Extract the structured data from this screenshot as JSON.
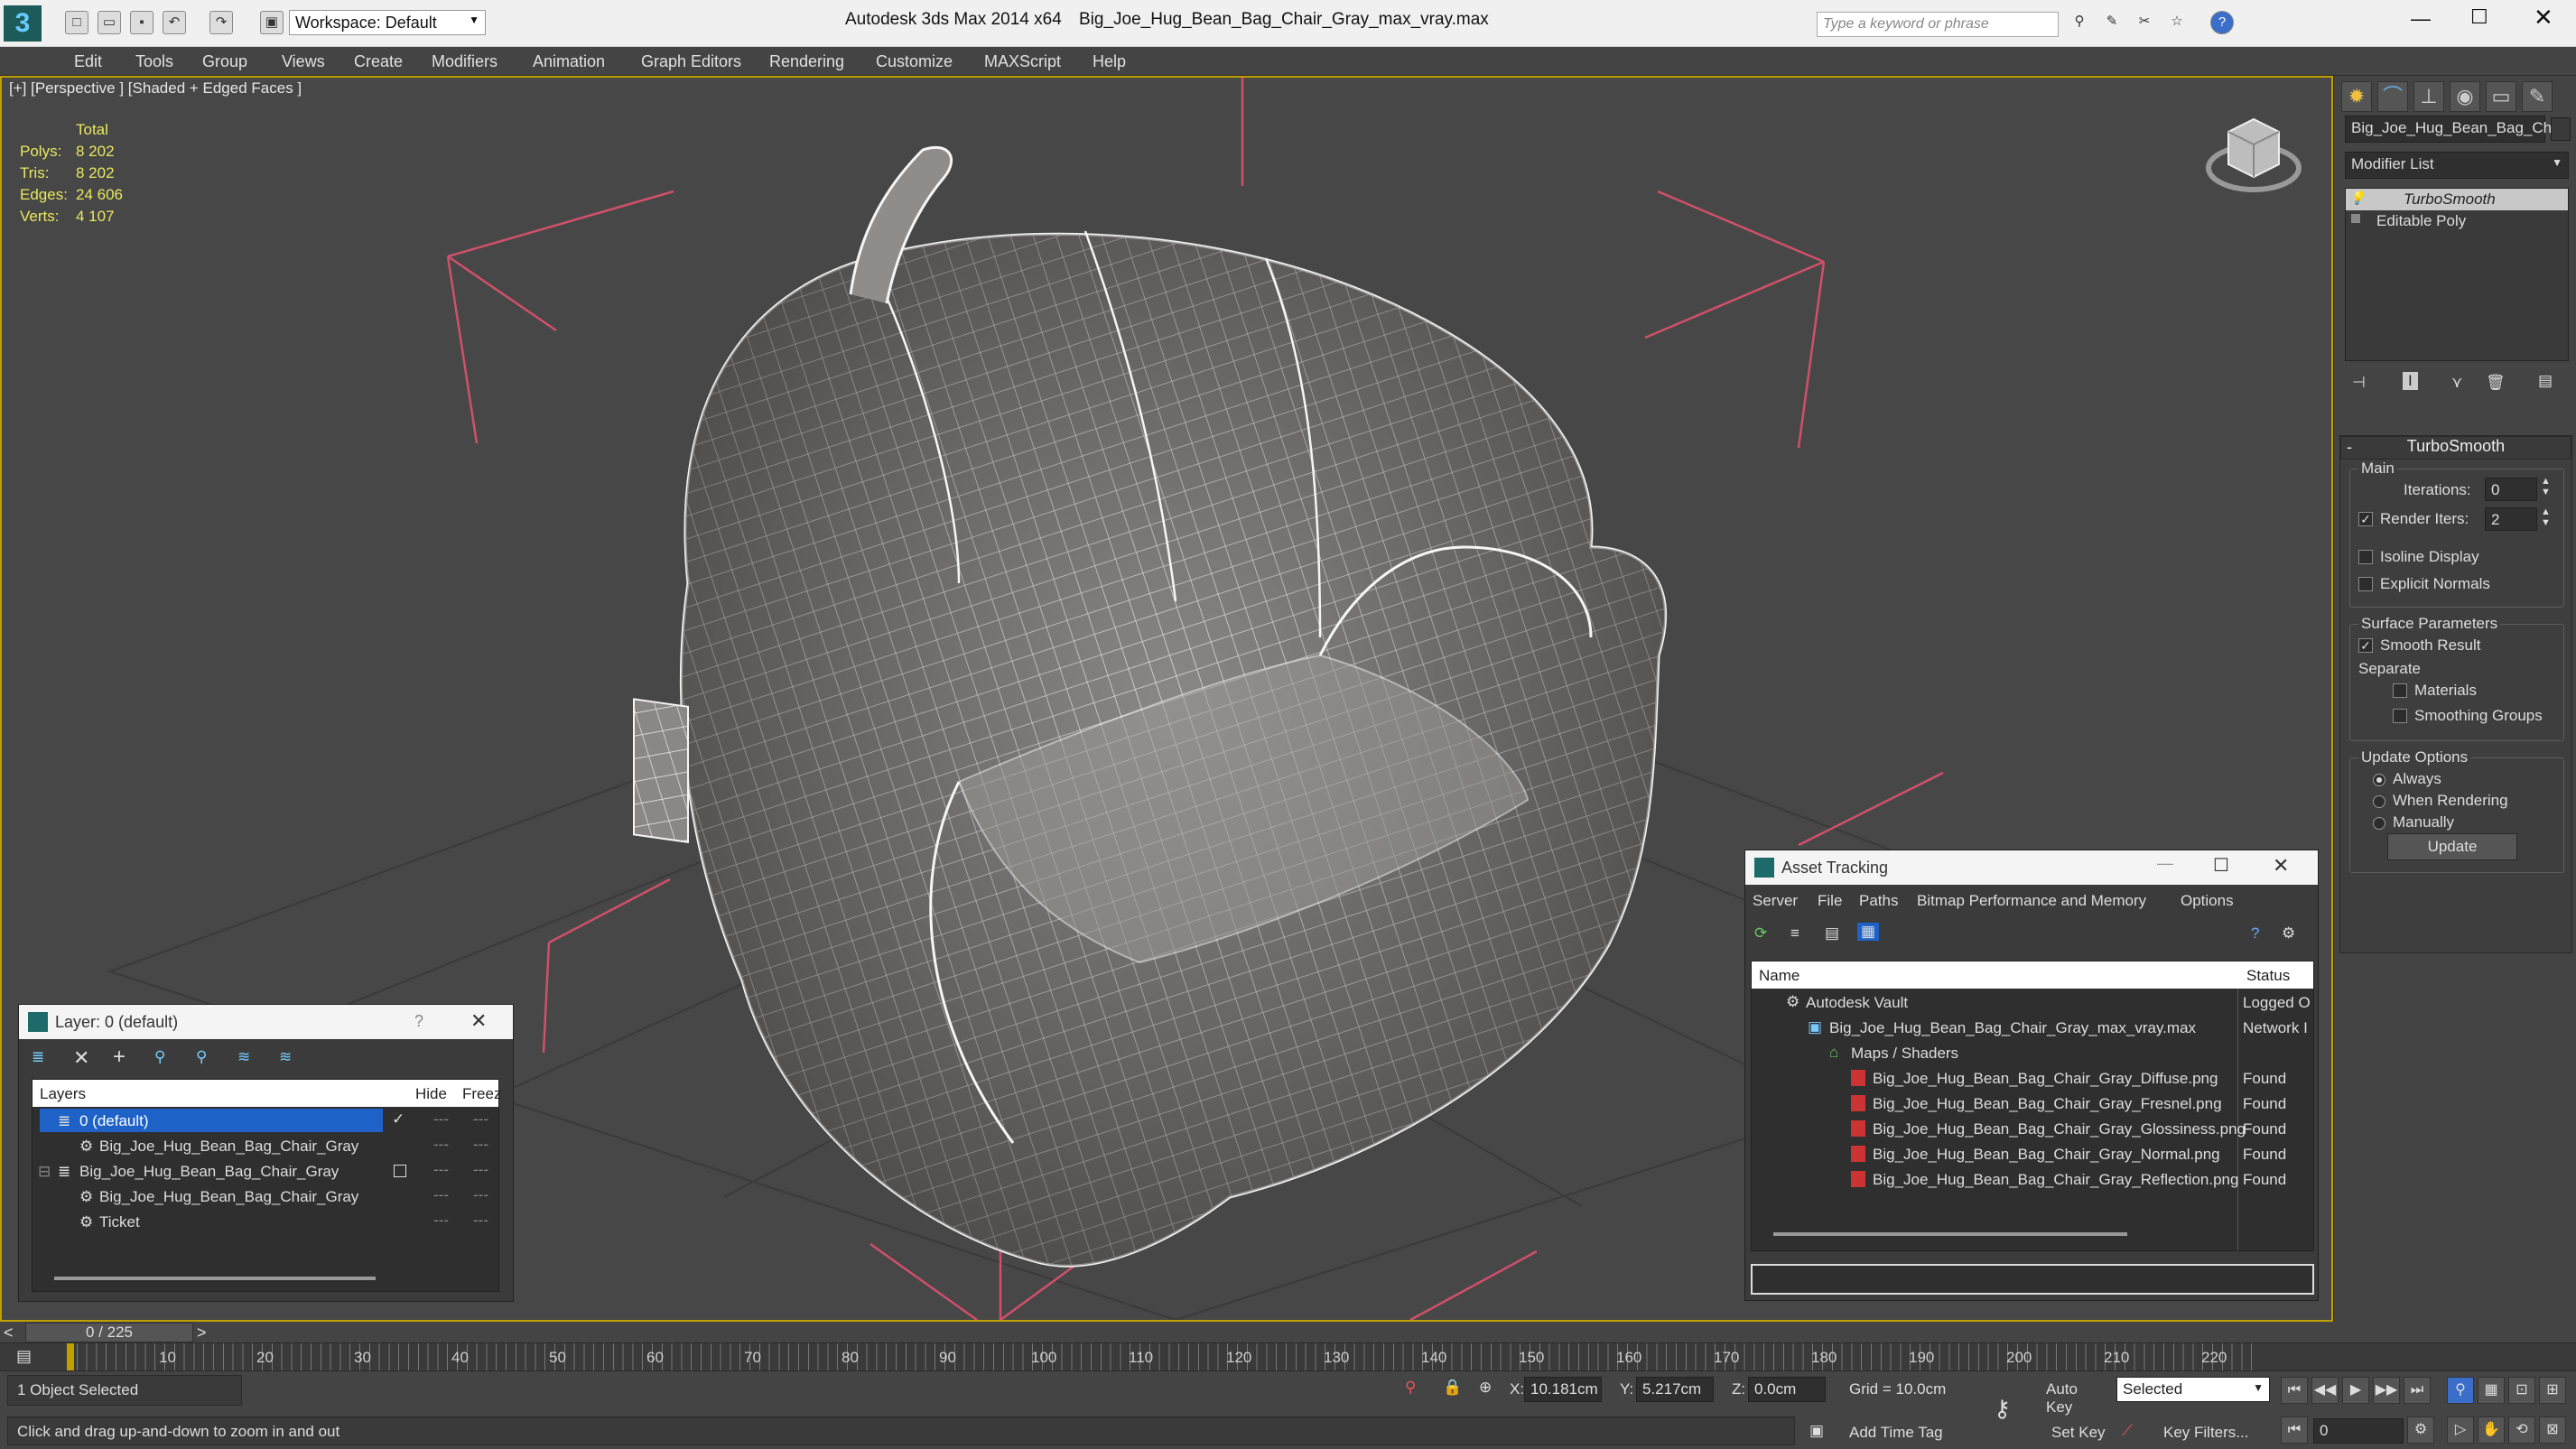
{
  "window": {
    "app_title": "Autodesk 3ds Max  2014 x64",
    "file_title": "Big_Joe_Hug_Bean_Bag_Chair_Gray_max_vray.max",
    "workspace": "Workspace: Default",
    "search_placeholder": "Type a keyword or phrase"
  },
  "menu": [
    "Edit",
    "Tools",
    "Group",
    "Views",
    "Create",
    "Modifiers",
    "Animation",
    "Graph Editors",
    "Rendering",
    "Customize",
    "MAXScript",
    "Help"
  ],
  "viewport": {
    "label": "[+] [Perspective ] [Shaded + Edged Faces ]",
    "stats": {
      "header": "Total",
      "rows": [
        {
          "k": "Polys:",
          "v": "8 202"
        },
        {
          "k": "Tris:",
          "v": "8 202"
        },
        {
          "k": "Edges:",
          "v": "24 606"
        },
        {
          "k": "Verts:",
          "v": "4 107"
        }
      ]
    }
  },
  "command_panel": {
    "object_name": "Big_Joe_Hug_Bean_Bag_Cha",
    "modifier_list": "Modifier List",
    "stack": [
      "TurboSmooth",
      "Editable Poly"
    ],
    "turbosmooth": {
      "title": "TurboSmooth",
      "main": "Main",
      "iterations_label": "Iterations:",
      "iterations": "0",
      "render_iters_label": "Render Iters:",
      "render_iters": "2",
      "isoline": "Isoline Display",
      "explicit_normals": "Explicit Normals",
      "surface_params": "Surface Parameters",
      "smooth_result": "Smooth Result",
      "separate": "Separate",
      "materials": "Materials",
      "smoothing_groups": "Smoothing Groups",
      "update_options": "Update Options",
      "always": "Always",
      "when_rendering": "When Rendering",
      "manually": "Manually",
      "update_button": "Update"
    }
  },
  "layer_dialog": {
    "title": "Layer: 0 (default)",
    "help": "?",
    "col_layers": "Layers",
    "col_hide": "Hide",
    "col_freeze": "Freez",
    "rows": [
      {
        "name": "0 (default)",
        "selected": true
      },
      {
        "name": "Big_Joe_Hug_Bean_Bag_Chair_Gray",
        "selected": false
      },
      {
        "name": "Big_Joe_Hug_Bean_Bag_Chair_Gray",
        "selected": false
      },
      {
        "name": "Big_Joe_Hug_Bean_Bag_Chair_Gray",
        "selected": false
      },
      {
        "name": "Ticket",
        "selected": false
      }
    ]
  },
  "asset_tracking": {
    "title": "Asset Tracking",
    "menu": [
      "Server",
      "File",
      "Paths",
      "Bitmap Performance and Memory",
      "Options"
    ],
    "col_name": "Name",
    "col_status": "Status",
    "rows": [
      {
        "name": "Autodesk Vault",
        "status": "Logged O"
      },
      {
        "name": "Big_Joe_Hug_Bean_Bag_Chair_Gray_max_vray.max",
        "status": "Network I"
      },
      {
        "name": "Maps / Shaders",
        "status": ""
      },
      {
        "name": "Big_Joe_Hug_Bean_Bag_Chair_Gray_Diffuse.png",
        "status": "Found"
      },
      {
        "name": "Big_Joe_Hug_Bean_Bag_Chair_Gray_Fresnel.png",
        "status": "Found"
      },
      {
        "name": "Big_Joe_Hug_Bean_Bag_Chair_Gray_Glossiness.png",
        "status": "Found"
      },
      {
        "name": "Big_Joe_Hug_Bean_Bag_Chair_Gray_Normal.png",
        "status": "Found"
      },
      {
        "name": "Big_Joe_Hug_Bean_Bag_Chair_Gray_Reflection.png",
        "status": "Found"
      }
    ]
  },
  "timeline": {
    "frame": "0 / 225",
    "ticks": [
      "10",
      "20",
      "30",
      "40",
      "50",
      "60",
      "70",
      "80",
      "90",
      "100",
      "110",
      "120",
      "130",
      "140",
      "150",
      "160",
      "170",
      "180",
      "190",
      "200",
      "210",
      "220"
    ]
  },
  "status": {
    "selection": "1 Object Selected",
    "prompt": "Click and drag up-and-down to zoom in and out",
    "x_label": "X:",
    "x": "10.181cm",
    "y_label": "Y:",
    "y": "5.217cm",
    "z_label": "Z:",
    "z": "0.0cm",
    "grid": "Grid = 10.0cm",
    "auto_key": "Auto Key",
    "auto_key_mode": "Selected",
    "set_key": "Set Key",
    "key_filters": "Key Filters...",
    "add_time_tag": "Add Time Tag",
    "current_frame": "0"
  },
  "colors": {
    "accent": "#c0a000",
    "selection": "#1e62c8",
    "stats": "#e8e860",
    "wire_bbox": "#d0506a"
  }
}
